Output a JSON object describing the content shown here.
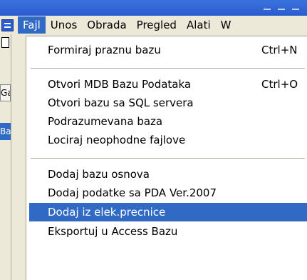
{
  "menubar": {
    "items": [
      {
        "label": "Fajl"
      },
      {
        "label": "Unos"
      },
      {
        "label": "Obrada"
      },
      {
        "label": "Pregled"
      },
      {
        "label": "Alati"
      },
      {
        "label": "W"
      }
    ]
  },
  "leftstrip": {
    "tab_label": "Ga",
    "selected_label": "Ba"
  },
  "fajl_menu": {
    "items": [
      {
        "label": "Formiraj praznu bazu",
        "shortcut": "Ctrl+N"
      },
      {
        "label": "Otvori MDB Bazu Podataka",
        "shortcut": "Ctrl+O"
      },
      {
        "label": "Otvori bazu sa SQL servera",
        "shortcut": ""
      },
      {
        "label": "Podrazumevana baza",
        "shortcut": ""
      },
      {
        "label": "Lociraj neophodne fajlove",
        "shortcut": ""
      },
      {
        "label": "Dodaj bazu osnova",
        "shortcut": ""
      },
      {
        "label": "Dodaj podatke sa PDA Ver.2007",
        "shortcut": ""
      },
      {
        "label": "Dodaj iz elek.precnice",
        "shortcut": ""
      },
      {
        "label": "Eksportuj u  Access Bazu",
        "shortcut": ""
      }
    ]
  },
  "colors": {
    "highlight": "#316ac5",
    "titlebar": "#2a5bd0",
    "menu_bg": "#ece9d8"
  }
}
